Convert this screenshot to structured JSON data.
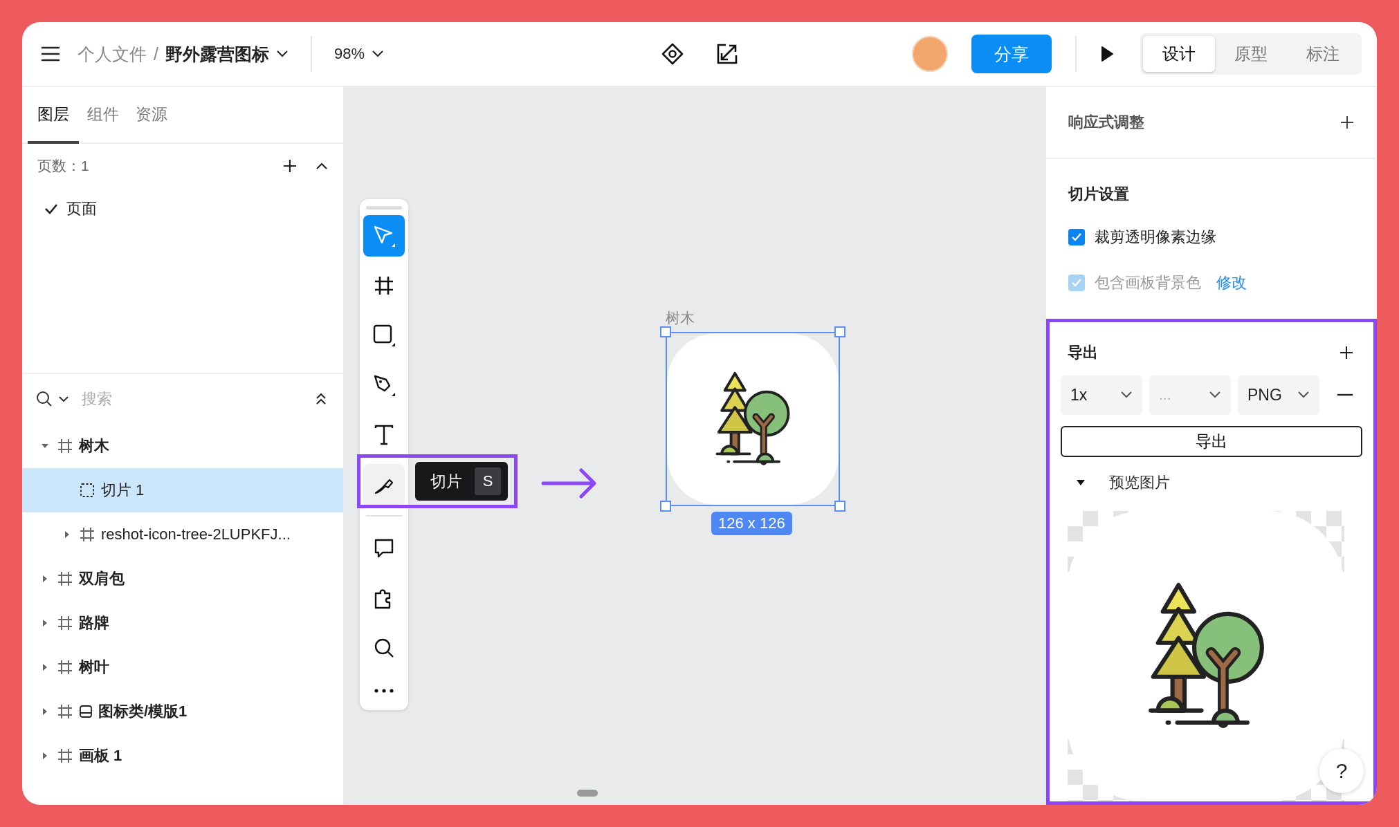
{
  "topbar": {
    "breadcrumb_parent": "个人文件",
    "separator": "/",
    "file_name": "野外露营图标",
    "zoom": "98%",
    "share_button": "分享",
    "mode_tabs": [
      {
        "label": "设计",
        "selected": true
      },
      {
        "label": "原型",
        "selected": false
      },
      {
        "label": "标注",
        "selected": false
      }
    ]
  },
  "left_panel": {
    "tabs": [
      {
        "label": "图层",
        "selected": true
      },
      {
        "label": "组件",
        "selected": false
      },
      {
        "label": "资源",
        "selected": false
      }
    ],
    "pages_label": "页数：1",
    "pages": [
      {
        "label": "页面",
        "selected": true
      }
    ],
    "search": {
      "placeholder": "搜索"
    },
    "layers": [
      {
        "name": "树木",
        "kind": "frame",
        "expanded": true,
        "selected": false,
        "children": [
          {
            "name": "切片 1",
            "kind": "slice",
            "selected": true
          },
          {
            "name": "reshot-icon-tree-2LUPKFJ...",
            "kind": "frame",
            "expanded": false,
            "selected": false
          }
        ]
      },
      {
        "name": "双肩包",
        "kind": "frame",
        "expanded": false,
        "selected": false
      },
      {
        "name": "路牌",
        "kind": "frame",
        "expanded": false,
        "selected": false
      },
      {
        "name": "树叶",
        "kind": "frame",
        "expanded": false,
        "selected": false
      },
      {
        "name": "图标类/模版1",
        "kind": "template",
        "expanded": false,
        "selected": false
      },
      {
        "name": "画板 1",
        "kind": "frame",
        "expanded": false,
        "selected": false
      }
    ]
  },
  "canvas": {
    "tool_groups": [
      [
        {
          "kind": "select",
          "selected": true,
          "hovered": false
        },
        {
          "kind": "frame",
          "selected": false,
          "hovered": false
        },
        {
          "kind": "rectangle",
          "selected": false,
          "hovered": false
        },
        {
          "kind": "pen",
          "selected": false,
          "hovered": false
        },
        {
          "kind": "text",
          "selected": false,
          "hovered": false
        },
        {
          "kind": "slice",
          "selected": false,
          "hovered": true
        }
      ],
      [
        {
          "kind": "comment",
          "selected": false,
          "hovered": false
        },
        {
          "kind": "plugin",
          "selected": false,
          "hovered": false
        },
        {
          "kind": "search",
          "selected": false,
          "hovered": false
        },
        {
          "kind": "more",
          "selected": false,
          "hovered": false
        }
      ]
    ],
    "tooltip": {
      "label": "切片",
      "shortcut": "S"
    },
    "artboard": {
      "label": "树木",
      "size": "126 x 126"
    }
  },
  "right_panel": {
    "responsive_title": "响应式调整",
    "slice_title": "切片设置",
    "slice_options": [
      {
        "label": "裁剪透明像素边缘",
        "checked": true,
        "disabled": false
      },
      {
        "label": "包含画板背景色",
        "checked": true,
        "disabled": true,
        "link": "修改"
      }
    ],
    "export": {
      "title": "导出",
      "selects": [
        {
          "value": "1x"
        },
        {
          "placeholder": "..."
        },
        {
          "value": "PNG"
        }
      ],
      "button": "导出",
      "preview_label": "预览图片",
      "preview_expanded": true
    },
    "help": "?"
  }
}
